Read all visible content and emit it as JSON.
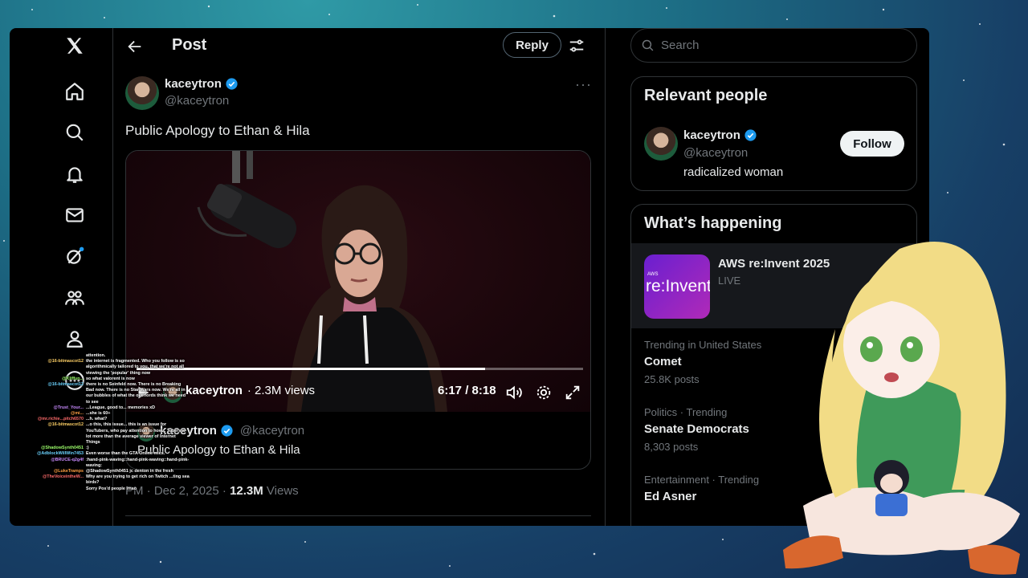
{
  "header": {
    "title": "Post",
    "reply_label": "Reply"
  },
  "nav": {
    "items": [
      "x-logo",
      "home-icon",
      "search-icon",
      "notifications-icon",
      "messages-icon",
      "grok-icon",
      "communities-icon",
      "profile-icon",
      "more-icon"
    ]
  },
  "tweet": {
    "author_name": "kaceytron",
    "author_handle": "@kaceytron",
    "text": "Public Apology to Ethan & Hila",
    "video": {
      "overlay_name": "kaceytron",
      "views_label": "· 2.3M views",
      "time": "6:17 / 8:18",
      "progress": 0.78
    },
    "quote_name": "kaceytron",
    "quote_handle": "@kaceytron",
    "quote_text": "Public Apology to Ethan & Hila",
    "meta_time": "PM · Dec 2, 2025 · ",
    "meta_views_count": "12.3M",
    "meta_views_label": " Views"
  },
  "search": {
    "placeholder": "Search"
  },
  "relevant": {
    "title": "Relevant people",
    "name": "kaceytron",
    "handle": "@kaceytron",
    "bio": "radicalized woman",
    "follow_label": "Follow"
  },
  "happening": {
    "title": "What’s happening",
    "event": {
      "name": "AWS re:Invent 2025",
      "status": "LIVE",
      "thumb_text": "re:Invent",
      "thumb_small": "AWS"
    },
    "trends": [
      {
        "label": "Trending in United States",
        "name": "Comet",
        "count": "25.8K posts"
      },
      {
        "label": "Politics · Trending",
        "name": "Senate Democrats",
        "count": "8,303 posts"
      },
      {
        "label": "Entertainment · Trending",
        "name": "Ed Asner",
        "count": ""
      }
    ]
  },
  "chat": [
    {
      "user": "",
      "msg": "attention."
    },
    {
      "user": "@16-bitmascot12",
      "msg": "the internet is fragmented. Who you follow is so algorithmically tailored to you, that we're not all viewing the 'popular' thing now"
    },
    {
      "user": "@Kliffun...",
      "msg": "so what valorent is now"
    },
    {
      "user": "@16-bitmascot12",
      "msg": "there is no Seinfeld now. There is no Breaking Bad now. There is no Star Wars now. We're all in our bubbles of what the overlords think we need to see"
    },
    {
      "user": "@Trust_Your...",
      "msg": "...League, good to... memories xD"
    },
    {
      "user": "@mi...",
      "msg": "...she is 60+"
    },
    {
      "user": "@mr.richie...pitch6570",
      "msg": "...h. what?"
    },
    {
      "user": "@16-bitmascot12",
      "msg": "...o this, this issue... this is an issue for YouTubers, who pay attention to how... Tubers a lot more than the average viewer of Internet Things"
    },
    {
      "user": "@ShadowSynth0451",
      "msg": ":)"
    },
    {
      "user": "@AdblockWillWin7453",
      "msg": "Even worse than the GTA Online mics."
    },
    {
      "user": "@BRUCE-q2g4f",
      "msg": ":hand-pink-waving::hand-pink-waving::hand-pink-waving:"
    },
    {
      "user": "@LukeTramps",
      "msg": "@ShadowSynth0451 jc denton in the fresh"
    },
    {
      "user": "@TheVoiceintheW...",
      "msg": "Why are you trying to get rich on Twitch ...ting sea birds?"
    },
    {
      "user": "",
      "msg": "Sorry Pos'd people lmao"
    }
  ],
  "colors": {
    "background": "#000000",
    "text": "#e7e9ea",
    "muted": "#71767b",
    "border": "#2f3336",
    "verified": "#1d9bf0"
  }
}
